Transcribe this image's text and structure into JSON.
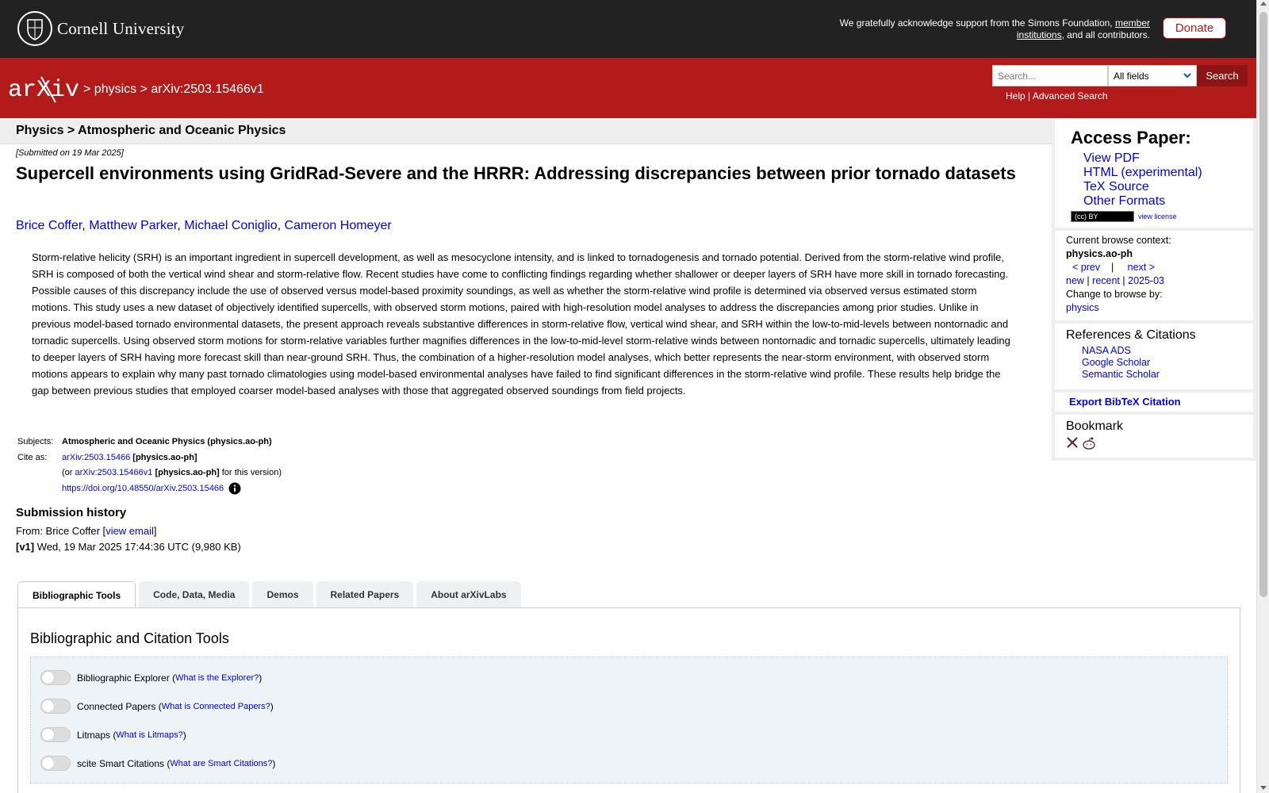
{
  "top_bar": {
    "university": "Cornell University",
    "support_text_pre": "We gratefully acknowledge support from the Simons Foundation,",
    "support_link": "member institutions",
    "support_text_post": ", and all contributors.",
    "donate_label": "Donate"
  },
  "header": {
    "logo_text": "arXiv",
    "breadcrumb_sep1": ">",
    "breadcrumb_1": "physics",
    "breadcrumb_sep2": ">",
    "breadcrumb_2": "arXiv:2503.15466v1",
    "search_placeholder": "Search...",
    "field_select": "All fields",
    "search_button": "Search",
    "help": "Help",
    "help_sep": "|",
    "advanced": "Advanced Search"
  },
  "paper": {
    "subheader": "Physics > Atmospheric and Oceanic Physics",
    "dateline": "[Submitted on 19 Mar 2025]",
    "title": "Supercell environments using GridRad-Severe and the HRRR: Addressing discrepancies between prior tornado datasets",
    "authors": [
      "Brice Coffer",
      "Matthew Parker",
      "Michael Coniglio",
      "Cameron Homeyer"
    ],
    "author_sep": ", ",
    "abstract": "Storm-relative helicity (SRH) is an important ingredient in supercell development, as well as mesocyclone intensity, and is linked to tornadogenesis and tornado potential. Derived from the storm-relative wind profile, SRH is composed of both the vertical wind shear and storm-relative flow. Recent studies have come to conflicting findings regarding whether shallower or deeper layers of SRH have more skill in tornado forecasting. Possible causes of this discrepancy include the use of observed versus model-based proximity soundings, as well as whether the storm-relative wind profile is determined via observed versus estimated storm motions. This study uses a new dataset of objectively identified supercells, with observed storm motions, paired with high-resolution model analyses to address the discrepancies among prior studies. Unlike in previous model-based tornado environmental datasets, the present approach reveals substantive differences in storm-relative flow, vertical wind shear, and SRH within the low-to-mid-levels between nontornadic and tornadic supercells. Using observed storm motions for storm-relative variables further magnifies differences in the low-to-mid-level storm-relative winds between nontornadic and tornadic supercells, ultimately leading to deeper layers of SRH having more forecast skill than near-ground SRH. Thus, the combination of a higher-resolution model analyses, which better represents the near-storm environment, with observed storm motions appears to explain why many past tornado climatologies using model-based environmental analyses have failed to find significant differences in the storm-relative wind profile. These results help bridge the gap between previous studies that employed coarser model-based analyses with those that aggregated observed soundings from field projects.",
    "subjects_label": "Subjects:",
    "subjects_value": "Atmospheric and Oceanic Physics (physics.ao-ph)",
    "cite_label": "Cite as:",
    "cite_id": "arXiv:2503.15466",
    "cite_cat": "[physics.ao-ph]",
    "cite_or": "(or",
    "cite_version": "arXiv:2503.15466v1",
    "cite_version_cat": "[physics.ao-ph]",
    "cite_version_post": "for this version)",
    "doi": "https://doi.org/10.48550/arXiv.2503.15466",
    "info_icon": "info-icon",
    "history_heading": "Submission history",
    "from_label": "From: Brice Coffer [",
    "view_email": "view email",
    "from_close": "]",
    "v1_tag": "[v1]",
    "v1_text": "Wed, 19 Mar 2025 17:44:36 UTC (9,980 KB)"
  },
  "tabs": [
    "Bibliographic Tools",
    "Code, Data, Media",
    "Demos",
    "Related Papers",
    "About arXivLabs"
  ],
  "tools": {
    "heading": "Bibliographic and Citation Tools",
    "items": [
      {
        "label": "Bibliographic Explorer",
        "link": "What is the Explorer?"
      },
      {
        "label": "Connected Papers",
        "link": "What is Connected Papers?"
      },
      {
        "label": "Litmaps",
        "link": "What is Litmaps?"
      },
      {
        "label": "scite Smart Citations",
        "link": "What are Smart Citations?"
      }
    ]
  },
  "sidebar": {
    "access_heading": "Access Paper:",
    "access_links": [
      "View PDF",
      "HTML (experimental)",
      "TeX Source",
      "Other Formats"
    ],
    "license_badge": "(cc) BY",
    "view_license": "view license",
    "browse_context_label": "Current browse context:",
    "browse_context": "physics.ao-ph",
    "prev": "< prev",
    "nav_sep": "|",
    "next": "next >",
    "new": "new",
    "recent": "recent",
    "month": "2025-03",
    "change_browse": "Change to browse by:",
    "browse_physics": "physics",
    "refs_heading": "References & Citations",
    "refs_links": [
      "NASA ADS",
      "Google Scholar",
      "Semantic Scholar"
    ],
    "bibtex": "Export BibTeX Citation",
    "bookmark_heading": "Bookmark"
  }
}
